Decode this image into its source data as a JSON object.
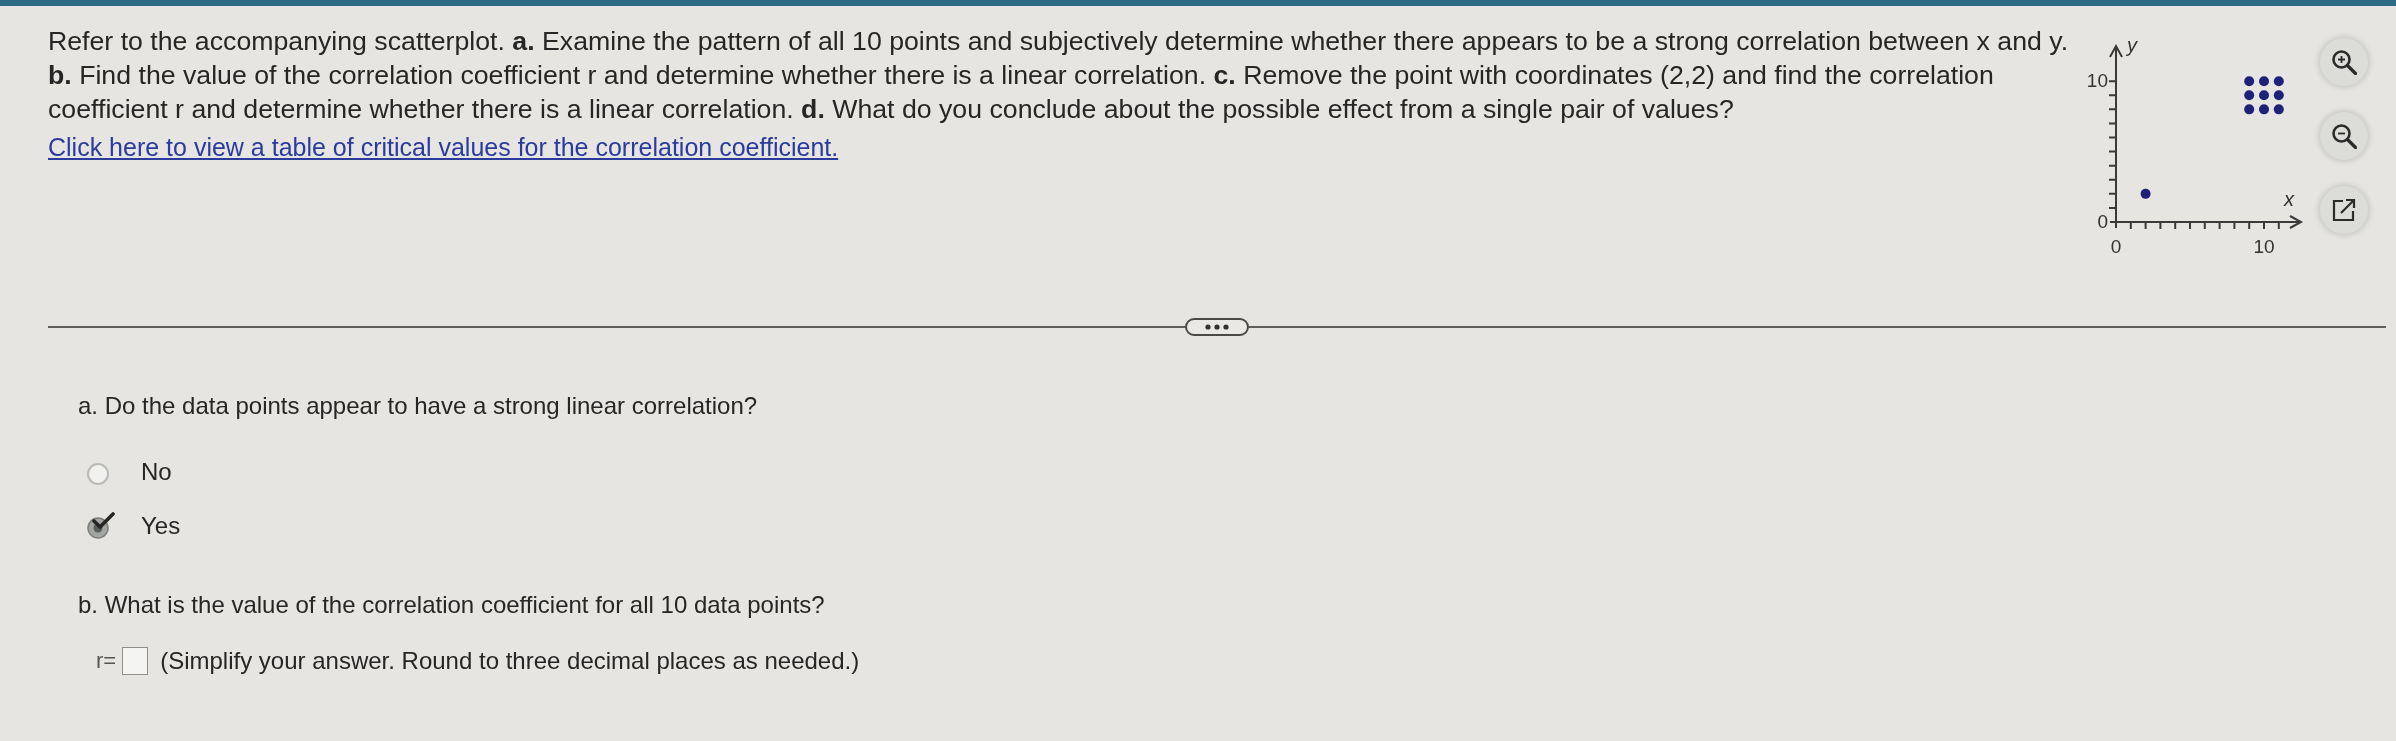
{
  "problem": {
    "text": "Refer to the accompanying scatterplot. **a.** Examine the pattern of all 10 points and subjectively determine whether there appears to be a strong correlation between x and y. **b.** Find the value of the correlation coefficient r and determine whether there is a linear correlation. **c.** Remove the point with coordinates (2,2) and find the correlation coefficient r and determine whether there is a linear correlation. **d.** What do you conclude about the possible effect from a single pair of values?",
    "link": "Click here to view a table of critical values for the correlation coefficient.",
    "chart_data": {
      "type": "scatter",
      "xlabel": "x",
      "ylabel": "y",
      "x": [
        2,
        9,
        10,
        11,
        9,
        10,
        11,
        9,
        10,
        11
      ],
      "series": [
        {
          "color": "#1d2178",
          "values": [
            2,
            10,
            10,
            10,
            9,
            9,
            9,
            8,
            8,
            8
          ]
        }
      ],
      "xlim": [
        0,
        12.5
      ],
      "ylim": [
        0,
        12.5
      ],
      "xticks": [
        0,
        10
      ],
      "yticks": [
        0,
        10
      ]
    }
  },
  "parts": [
    {
      "kind": "choice",
      "question": "a. Do the data points appear to have a strong linear correlation?",
      "options": [
        {
          "label": "No",
          "selected": false
        },
        {
          "label": "Yes",
          "selected": true
        }
      ]
    },
    {
      "kind": "answer",
      "question": "b. What is the value of the correlation coefficient for all 10 data points?",
      "label": "r=",
      "note": "(Simplify your answer. Round to three decimal places as needed.)"
    }
  ]
}
